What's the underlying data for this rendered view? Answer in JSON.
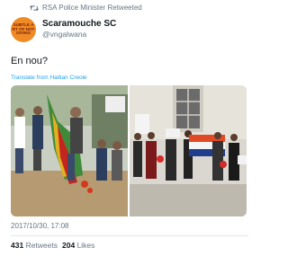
{
  "retweet_notice": {
    "icon": "retweet-icon",
    "text": "RSA Police Minister Retweeted"
  },
  "author": {
    "avatar_text": "SUBTLE ART OF NOT GIVING",
    "avatar_color": "#f08a24",
    "name": "Scaramouche SC",
    "handle": "@vngalwana"
  },
  "tweet": {
    "text": "En nou?",
    "translate_link": "Translate from Haitian Creole"
  },
  "timestamp": "2017/10/30, 17:08",
  "stats": {
    "retweets_count": "431",
    "retweets_label": "Retweets",
    "likes_count": "204",
    "likes_label": "Likes"
  },
  "colors": {
    "link": "#1da1f2",
    "muted": "#657786",
    "text": "#14171a"
  }
}
